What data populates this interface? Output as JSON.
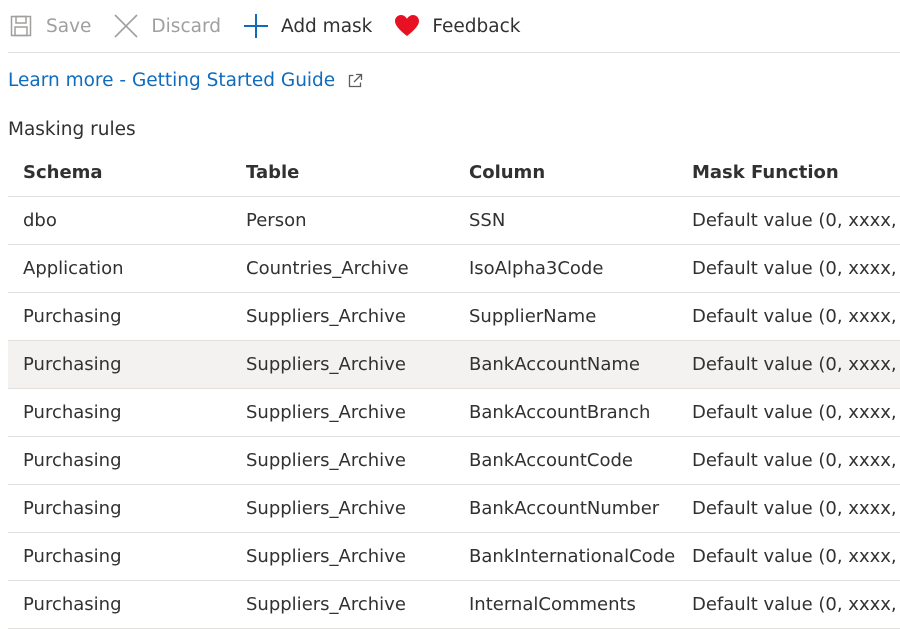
{
  "toolbar": {
    "save_label": "Save",
    "discard_label": "Discard",
    "add_mask_label": "Add mask",
    "feedback_label": "Feedback",
    "icons": {
      "save": "save-icon",
      "discard": "close-icon",
      "add_mask": "plus-icon",
      "feedback": "heart-icon"
    },
    "colors": {
      "accent": "#0f6cbd",
      "heart": "#e81123",
      "disabled": "#a19f9d"
    }
  },
  "learn_more": {
    "text": "Learn more - Getting Started Guide",
    "icon": "external-link-icon"
  },
  "masking_rules": {
    "title": "Masking rules",
    "columns": [
      "Schema",
      "Table",
      "Column",
      "Mask Function"
    ],
    "rows": [
      {
        "schema": "dbo",
        "table": "Person",
        "column": "SSN",
        "mask": "Default value (0, xxxx, ..."
      },
      {
        "schema": "Application",
        "table": "Countries_Archive",
        "column": "IsoAlpha3Code",
        "mask": "Default value (0, xxxx, ..."
      },
      {
        "schema": "Purchasing",
        "table": "Suppliers_Archive",
        "column": "SupplierName",
        "mask": "Default value (0, xxxx, ..."
      },
      {
        "schema": "Purchasing",
        "table": "Suppliers_Archive",
        "column": "BankAccountName",
        "mask": "Default value (0, xxxx, ..."
      },
      {
        "schema": "Purchasing",
        "table": "Suppliers_Archive",
        "column": "BankAccountBranch",
        "mask": "Default value (0, xxxx, ..."
      },
      {
        "schema": "Purchasing",
        "table": "Suppliers_Archive",
        "column": "BankAccountCode",
        "mask": "Default value (0, xxxx, ..."
      },
      {
        "schema": "Purchasing",
        "table": "Suppliers_Archive",
        "column": "BankAccountNumber",
        "mask": "Default value (0, xxxx, ..."
      },
      {
        "schema": "Purchasing",
        "table": "Suppliers_Archive",
        "column": "BankInternationalCode",
        "mask": "Default value (0, xxxx, ..."
      },
      {
        "schema": "Purchasing",
        "table": "Suppliers_Archive",
        "column": "InternalComments",
        "mask": "Default value (0, xxxx, ..."
      }
    ]
  }
}
